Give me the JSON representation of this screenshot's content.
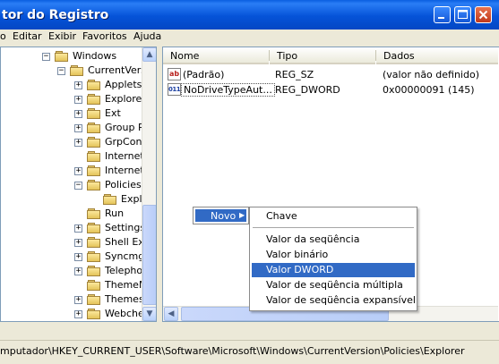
{
  "window": {
    "title": "tor do Registro"
  },
  "menubar": {
    "items": [
      "o",
      "Editar",
      "Exibir",
      "Favoritos",
      "Ajuda"
    ]
  },
  "tree": {
    "items": [
      {
        "label": "Windows",
        "expander": "−"
      },
      {
        "label": "CurrentVers",
        "expander": "−"
      },
      {
        "label": "Applets",
        "expander": "+"
      },
      {
        "label": "Explorer",
        "expander": "+"
      },
      {
        "label": "Ext",
        "expander": "+"
      },
      {
        "label": "Group P",
        "expander": "+"
      },
      {
        "label": "GrpConv",
        "expander": "+"
      },
      {
        "label": "Internet",
        "expander": ""
      },
      {
        "label": "Internet",
        "expander": "+"
      },
      {
        "label": "Policies",
        "expander": "−"
      },
      {
        "label": "Expl",
        "expander": ""
      },
      {
        "label": "Run",
        "expander": ""
      },
      {
        "label": "Settings",
        "expander": "+"
      },
      {
        "label": "Shell Ext",
        "expander": "+"
      },
      {
        "label": "Syncmg",
        "expander": "+"
      },
      {
        "label": "Telepho",
        "expander": "+"
      },
      {
        "label": "ThemeM",
        "expander": ""
      },
      {
        "label": "Themes",
        "expander": "+"
      },
      {
        "label": "Webche",
        "expander": "+"
      }
    ]
  },
  "list": {
    "columns": [
      "Nome",
      "Tipo",
      "Dados"
    ],
    "rows": [
      {
        "icon": "ab",
        "name": "(Padrão)",
        "type": "REG_SZ",
        "data": "(valor não definido)"
      },
      {
        "icon": "011",
        "name": "NoDriveTypeAut...",
        "type": "REG_DWORD",
        "data": "0x00000091 (145)"
      }
    ]
  },
  "context_menu": {
    "parent_label": "Novo",
    "arrow": "▶",
    "items": [
      "Chave",
      "Valor da seqüência",
      "Valor binário",
      "Valor DWORD",
      "Valor de seqüência múltipla",
      "Valor de seqüência expansível"
    ],
    "selected": "Valor DWORD"
  },
  "status": {
    "path": "mputador\\HKEY_CURRENT_USER\\Software\\Microsoft\\Windows\\CurrentVersion\\Policies\\Explorer"
  },
  "icons": {
    "minimize": "minimize-icon",
    "maximize": "maximize-icon",
    "close": "close-icon",
    "folder": "folder-icon",
    "string": "reg-string-icon",
    "binary": "reg-binary-icon"
  },
  "colors": {
    "titlebar": "#0553d8",
    "selection": "#316ac5",
    "folder": "#f3d36d"
  }
}
